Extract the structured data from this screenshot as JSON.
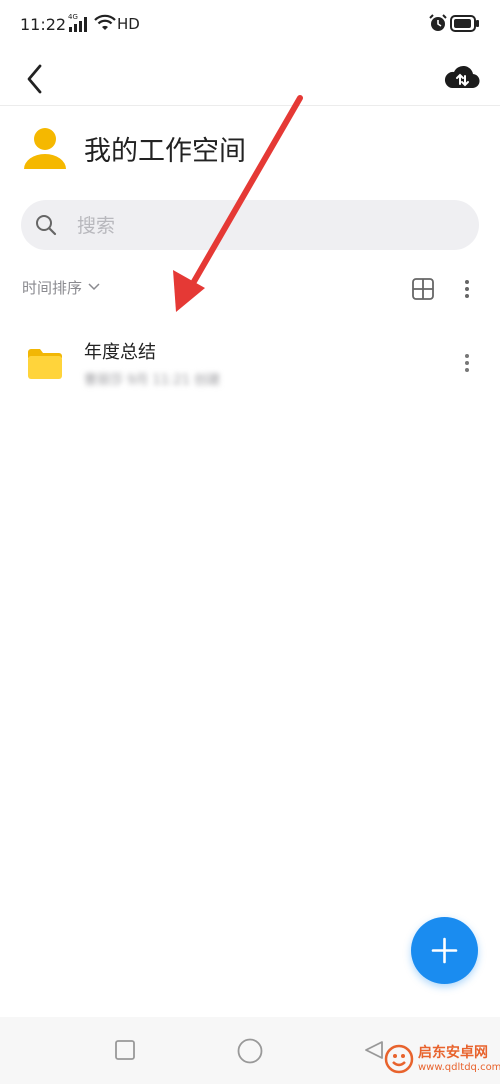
{
  "status_bar": {
    "time": "11:22",
    "network_badge": "4G",
    "hd": "HD"
  },
  "header": {
    "back_icon": "chevron-left-icon",
    "upload_icon": "cloud-upload-icon"
  },
  "workspace": {
    "title": "我的工作空间",
    "avatar_color": "#F5B800"
  },
  "search": {
    "placeholder": "搜索",
    "value": ""
  },
  "toolbar": {
    "sort_label": "时间排序",
    "view_icon": "grid-view-icon",
    "more_icon": "more-vertical-icon"
  },
  "files": [
    {
      "name": "年度总结",
      "meta": "曹丽莎 9月 11:21 创建",
      "icon": "folder-icon",
      "color": "#FFD43B"
    }
  ],
  "fab": {
    "icon": "plus-icon",
    "color": "#1A8CF0"
  },
  "annotation": {
    "arrow_color": "#E53935"
  },
  "watermark": {
    "title": "启东安卓网",
    "url": "www.qdltdq.com"
  }
}
